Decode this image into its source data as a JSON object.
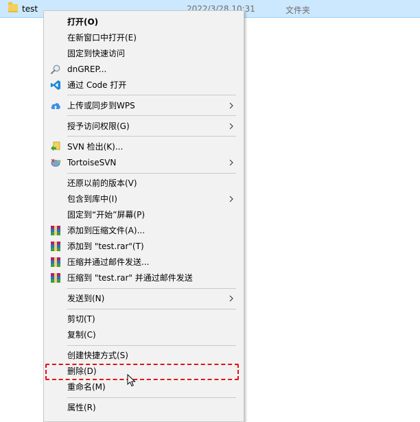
{
  "file": {
    "name": "test",
    "date": "2022/3/28 10:31",
    "type": "文件夹"
  },
  "menu": {
    "open": "打开(O)",
    "open_new_window": "在新窗口中打开(E)",
    "pin_quick_access": "固定到快速访问",
    "dngrep": "dnGREP...",
    "open_with_code": "通过 Code 打开",
    "wps_sync": "上传或同步到WPS",
    "grant_access": "授予访问权限(G)",
    "svn_checkout": "SVN 检出(K)...",
    "tortoise_svn": "TortoiseSVN",
    "restore_versions": "还原以前的版本(V)",
    "include_library": "包含到库中(I)",
    "pin_start": "固定到“开始”屏幕(P)",
    "add_archive": "添加到压缩文件(A)...",
    "add_test_rar": "添加到 \"test.rar\"(T)",
    "compress_email": "压缩并通过邮件发送...",
    "compress_rar_email": "压缩到 \"test.rar\" 并通过邮件发送",
    "send_to": "发送到(N)",
    "cut": "剪切(T)",
    "copy": "复制(C)",
    "create_shortcut": "创建快捷方式(S)",
    "delete": "删除(D)",
    "rename": "重命名(M)",
    "properties": "属性(R)"
  }
}
